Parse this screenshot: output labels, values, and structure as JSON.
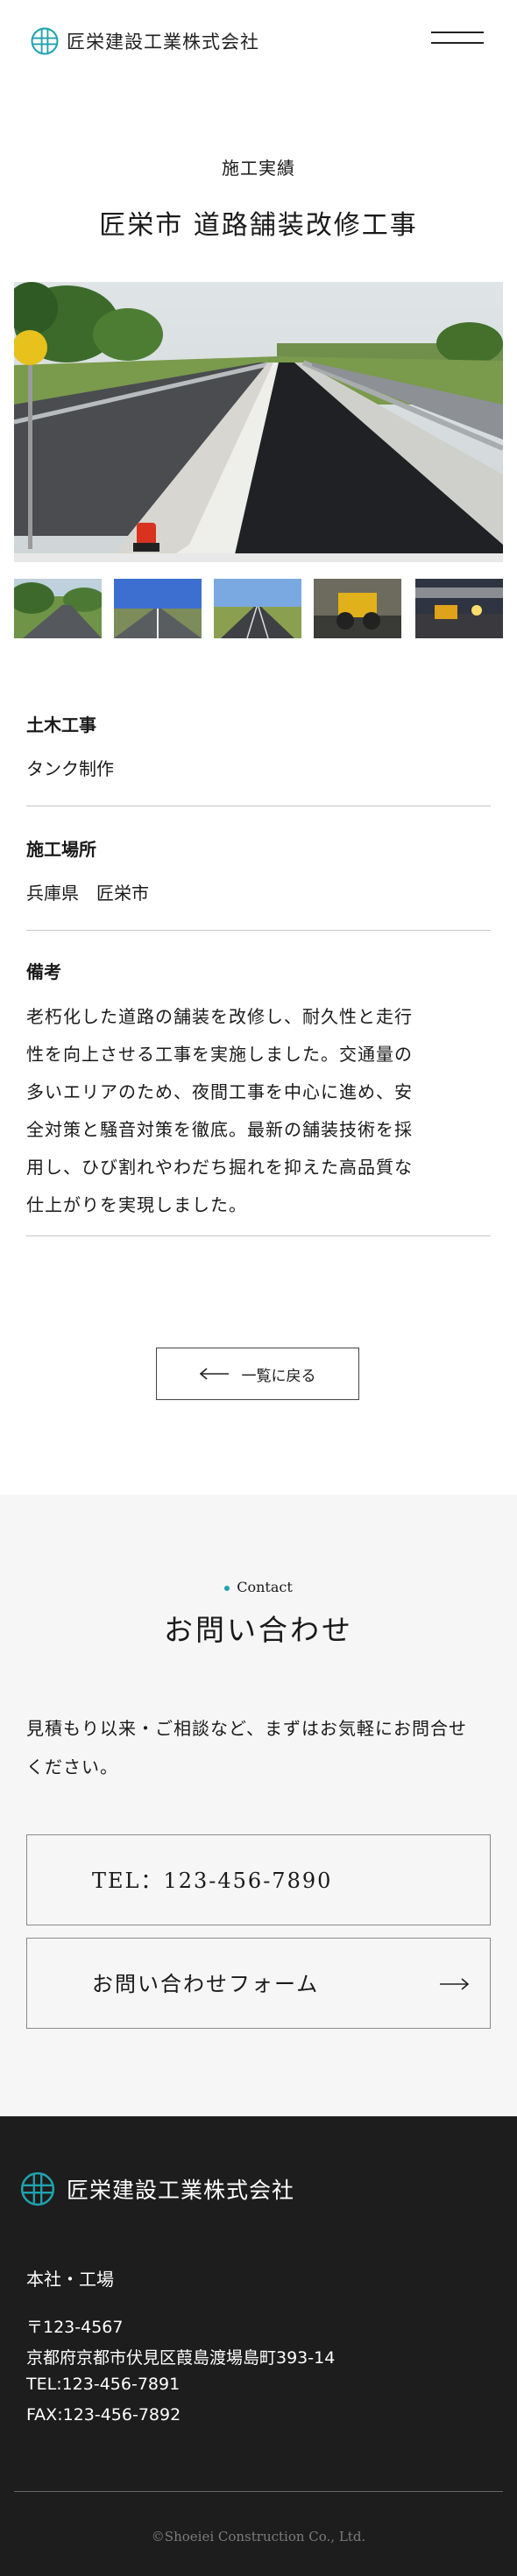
{
  "header": {
    "company_name": "匠栄建設工業株式会社",
    "menu_icon": "hamburger-icon"
  },
  "project": {
    "category": "施工実績",
    "title": "匠栄市 道路舗装改修工事",
    "thumbnail_count": 5,
    "details": [
      {
        "label": "土木工事",
        "value": "タンク制作"
      },
      {
        "label": "施工場所",
        "value": "兵庫県　匠栄市"
      },
      {
        "label": "備考",
        "lines": [
          "老朽化した道路の舗装を改修し、耐久性と走行",
          "性を向上させる工事を実施しました。交通量の",
          "多いエリアのため、夜間工事を中心に進め、安",
          "全対策と騒音対策を徹底。最新の舗装技術を採",
          "用し、ひび割れやわだち掘れを抑えた高品質な",
          "仕上がりを実現しました。"
        ]
      }
    ],
    "back_label": "一覧に戻る"
  },
  "contact": {
    "eyebrow": "Contact",
    "title": "お問い合わせ",
    "text_lines": [
      "見積もり以来・ご相談など、まずはお気軽にお問合せ",
      "ください。"
    ],
    "tel_label": "TEL：123-456-7890",
    "form_label": "お問い合わせフォーム"
  },
  "footer": {
    "company_name": "匠栄建設工業株式会社",
    "office_label": "本社・工場",
    "postal": "〒123-4567",
    "address": "京都府京都市伏見区葭島渡場島町393-14",
    "tel": "TEL:123-456-7891",
    "fax": "FAX:123-456-7892",
    "copyright": "©Shoeiei Construction Co., Ltd."
  },
  "colors": {
    "accent": "#1fa3ae",
    "footer_bg": "#1d1d1d",
    "contact_bg": "#f6f6f6"
  }
}
